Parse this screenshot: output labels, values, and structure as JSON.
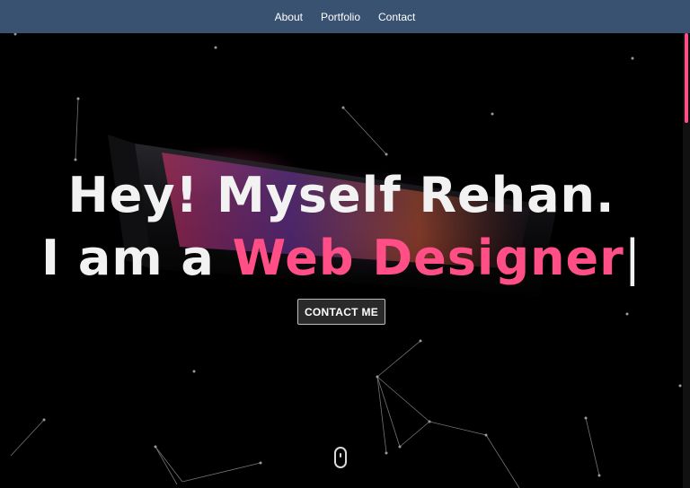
{
  "nav": {
    "items": [
      {
        "label": "About"
      },
      {
        "label": "Portfolio"
      },
      {
        "label": "Contact"
      }
    ]
  },
  "hero": {
    "line1": "Hey! Myself Rehan.",
    "line2_prefix": "I am a ",
    "typed_word": "Web Designer",
    "cursor": "|",
    "cta_label": "CONTACT ME"
  },
  "colors": {
    "nav_bg": "#3a5271",
    "accent": "#ff4f86",
    "text": "#f2f2f2",
    "background": "#000000"
  },
  "icons": {
    "scroll_indicator": "mouse-icon"
  }
}
